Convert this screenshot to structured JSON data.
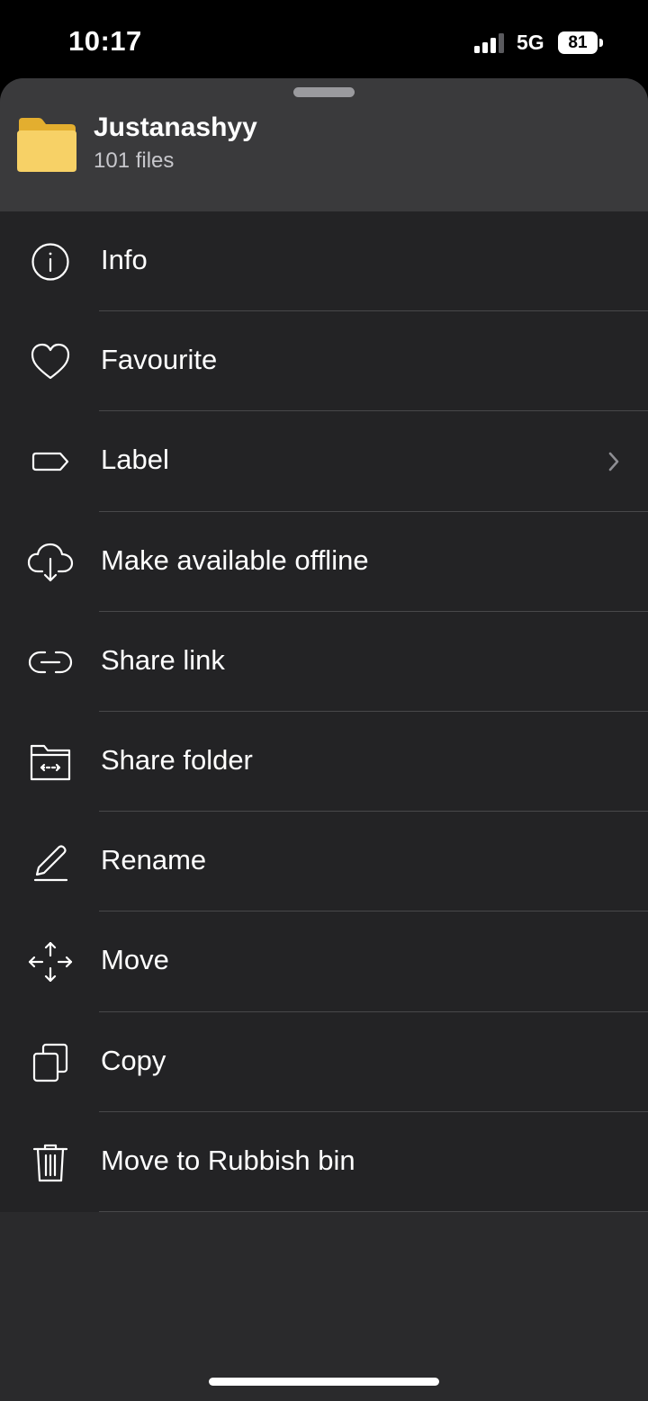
{
  "status_bar": {
    "time": "10:17",
    "network": "5G",
    "battery": "81"
  },
  "sheet": {
    "folder_name": "Justanashyy",
    "file_count": "101 files",
    "folder_color": "#f5c84c"
  },
  "menu": {
    "items": [
      {
        "label": "Info",
        "icon": "info-icon"
      },
      {
        "label": "Favourite",
        "icon": "heart-icon"
      },
      {
        "label": "Label",
        "icon": "label-tag-icon",
        "has_chevron": true
      },
      {
        "label": "Make available offline",
        "icon": "cloud-download-icon"
      },
      {
        "label": "Share link",
        "icon": "link-icon"
      },
      {
        "label": "Share folder",
        "icon": "share-folder-icon"
      },
      {
        "label": "Rename",
        "icon": "pencil-icon"
      },
      {
        "label": "Move",
        "icon": "move-arrows-icon"
      },
      {
        "label": "Copy",
        "icon": "copy-icon"
      },
      {
        "label": "Move to Rubbish bin",
        "icon": "trash-icon"
      }
    ]
  },
  "colors": {
    "sheet_background": "#2a2a2c",
    "header_background": "#3a3a3c",
    "list_background": "#232325",
    "separator": "#48484a"
  }
}
